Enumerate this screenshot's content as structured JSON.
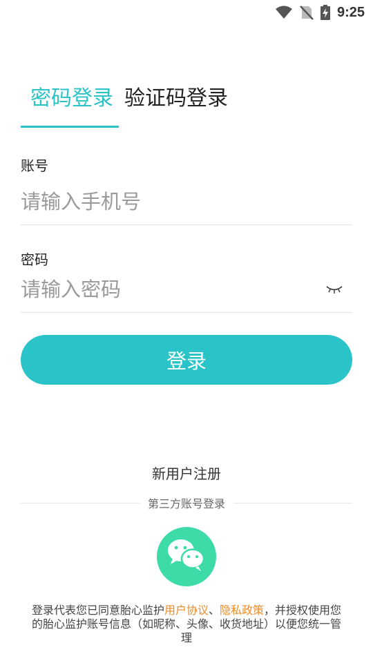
{
  "status_bar": {
    "time": "9:25",
    "icons": [
      "wifi-icon",
      "no-sim-icon",
      "battery-charging-icon"
    ]
  },
  "tabs": [
    {
      "label": "密码登录",
      "active": true
    },
    {
      "label": "验证码登录",
      "active": false
    }
  ],
  "account": {
    "label": "账号",
    "placeholder": "请输入手机号",
    "value": ""
  },
  "password": {
    "label": "密码",
    "placeholder": "请输入密码",
    "value": "",
    "toggle_icon": "eye-closed-icon"
  },
  "login_button": {
    "label": "登录"
  },
  "register_link": {
    "label": "新用户注册"
  },
  "third_party": {
    "divider_text": "第三方账号登录",
    "wechat_icon": "wechat-icon"
  },
  "agreement": {
    "prefix": "登录代表您已同意胎心监护",
    "user_agreement": "用户协议",
    "separator": "、",
    "privacy_policy": "隐私政策",
    "suffix": "，并授权使用您的胎心监护账号信息（如昵称、头像、收货地址）以便您统一管理"
  },
  "colors": {
    "accent": "#2ac4c8",
    "link": "#f08a24",
    "wechat": "#3ddba8"
  }
}
